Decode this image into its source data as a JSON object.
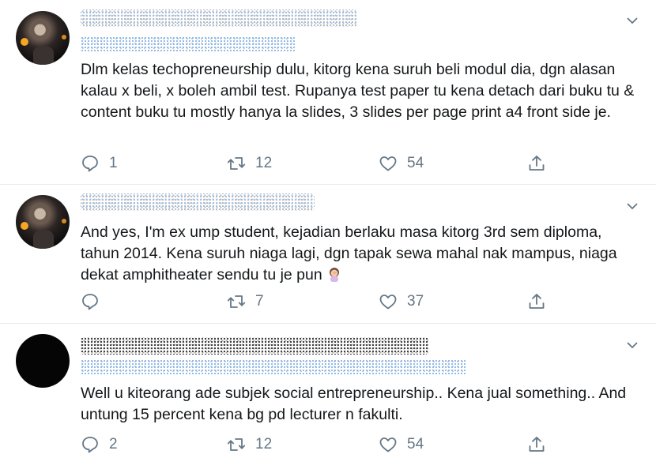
{
  "tweets": [
    {
      "text": "Dlm kelas techopreneurship dulu, kitorg kena suruh beli modul dia, dgn alasan kalau x beli, x boleh ambil test. Rupanya test paper tu kena detach dari buku tu & content buku tu mostly hanya la slides, 3 slides per page print a4 front side je.",
      "reply_count": "1",
      "retweet_count": "12",
      "like_count": "54"
    },
    {
      "text": "And yes, I'm ex ump student, kejadian berlaku masa kitorg 3rd sem diploma, tahun 2014. Kena suruh niaga lagi, dgn tapak sewa mahal nak mampus, niaga dekat amphitheater sendu tu je pun ",
      "emoji_icon": "woman-facepalming-icon",
      "reply_count": "",
      "retweet_count": "7",
      "like_count": "37"
    },
    {
      "text": "Well u kiteorang ade subjek social entrepreneurship.. Kena jual something.. And untung 15 percent kena bg pd lecturer n fakulti.",
      "reply_count": "2",
      "retweet_count": "12",
      "like_count": "54"
    }
  ],
  "icons": {
    "reply": "reply-icon",
    "retweet": "retweet-icon",
    "like": "like-icon",
    "share": "share-icon",
    "menu": "chevron-down-icon"
  },
  "colors": {
    "text": "#14171a",
    "muted": "#657786",
    "divider": "#e6ecf0"
  }
}
